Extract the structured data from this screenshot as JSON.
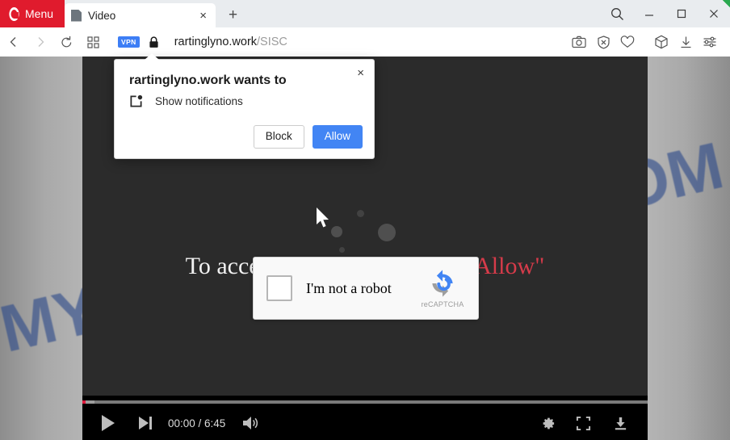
{
  "browser": {
    "menu_label": "Menu",
    "tab": {
      "title": "Video",
      "close_label": "×"
    },
    "new_tab_label": "+",
    "window_controls": {
      "search": "search-icon",
      "minimize": "—",
      "maximize": "□",
      "close": "×"
    },
    "nav": {
      "back": "back-icon",
      "forward": "forward-icon",
      "reload": "reload-icon",
      "speeddial": "speed-dial-icon"
    },
    "address": {
      "vpn_badge": "VPN",
      "lock": "lock-icon",
      "domain": "rartinglyno.work",
      "path": "/SISC"
    },
    "toolbar_icons": [
      "snapshot-camera-icon",
      "ad-blocker-shield-icon",
      "heart-icon",
      "cube-icon",
      "downloads-icon",
      "easy-setup-icon"
    ]
  },
  "permission_dialog": {
    "title": "rartinglyno.work wants to",
    "permission": "Show notifications",
    "icon": "notification-bell-icon",
    "close_label": "×",
    "block_label": "Block",
    "allow_label": "Allow",
    "allow_color": "#4285f4"
  },
  "page": {
    "watermark": "MYANTISPYWARE.COM",
    "watermark_color": "#2d4a8a",
    "headline_prefix": "To access to the video, click ",
    "headline_allow": "\"Allow\"",
    "headline_allow_color": "#d63b4a",
    "background_color": "#2b2b2b"
  },
  "recaptcha": {
    "label": "I'm not a robot",
    "brand": "reCAPTCHA",
    "checkbox_checked": false
  },
  "player": {
    "play_label": "play-icon",
    "next_label": "next-track-icon",
    "time": "00:00 / 6:45",
    "volume_label": "volume-icon",
    "settings_label": "settings-gear-icon",
    "fullscreen_label": "fullscreen-icon",
    "download_label": "download-icon",
    "progress_percent": 0
  }
}
